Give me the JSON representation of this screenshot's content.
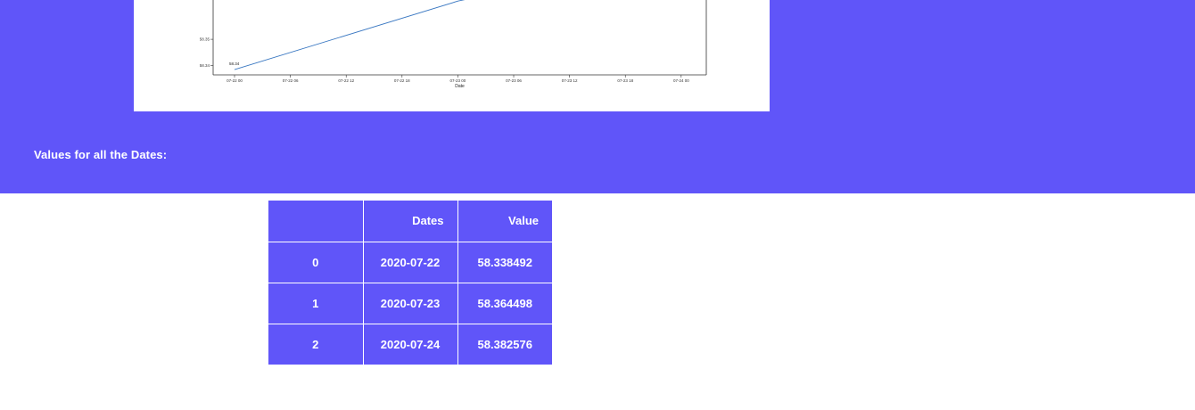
{
  "colors": {
    "accent": "#6055f9",
    "text_on_accent": "#ffffff",
    "line": "#3a78c2"
  },
  "heading": "Values for all the Dates:",
  "table": {
    "columns": [
      "",
      "Dates",
      "Value"
    ],
    "rows": [
      {
        "index": "0",
        "date": "2020-07-22",
        "value": "58.338492"
      },
      {
        "index": "1",
        "date": "2020-07-23",
        "value": "58.364498"
      },
      {
        "index": "2",
        "date": "2020-07-24",
        "value": "58.382576"
      }
    ]
  },
  "chart_data": {
    "type": "line",
    "xlabel": "Date",
    "ylabel": "",
    "x_tick_labels": [
      "07-22 00",
      "07-22 06",
      "07-22 12",
      "07-22 18",
      "07-23 00",
      "07-23 06",
      "07-23 12",
      "07-23 18",
      "07-24 00"
    ],
    "y_tick_labels": [
      "58.34",
      "58.35"
    ],
    "x_range_hours": [
      -2.3,
      50.7
    ],
    "ylim": [
      58.3365,
      58.3683
    ],
    "series": [
      {
        "points": [
          {
            "x": "07-22 00",
            "y": 58.338492
          },
          {
            "x": "07-23 00",
            "y": 58.364498
          },
          {
            "x": "07-24 00",
            "y": 58.382576
          }
        ],
        "values": [
          58.338492,
          58.364498,
          58.382576
        ]
      }
    ],
    "annotations": [
      "58.34"
    ],
    "grid": false
  }
}
